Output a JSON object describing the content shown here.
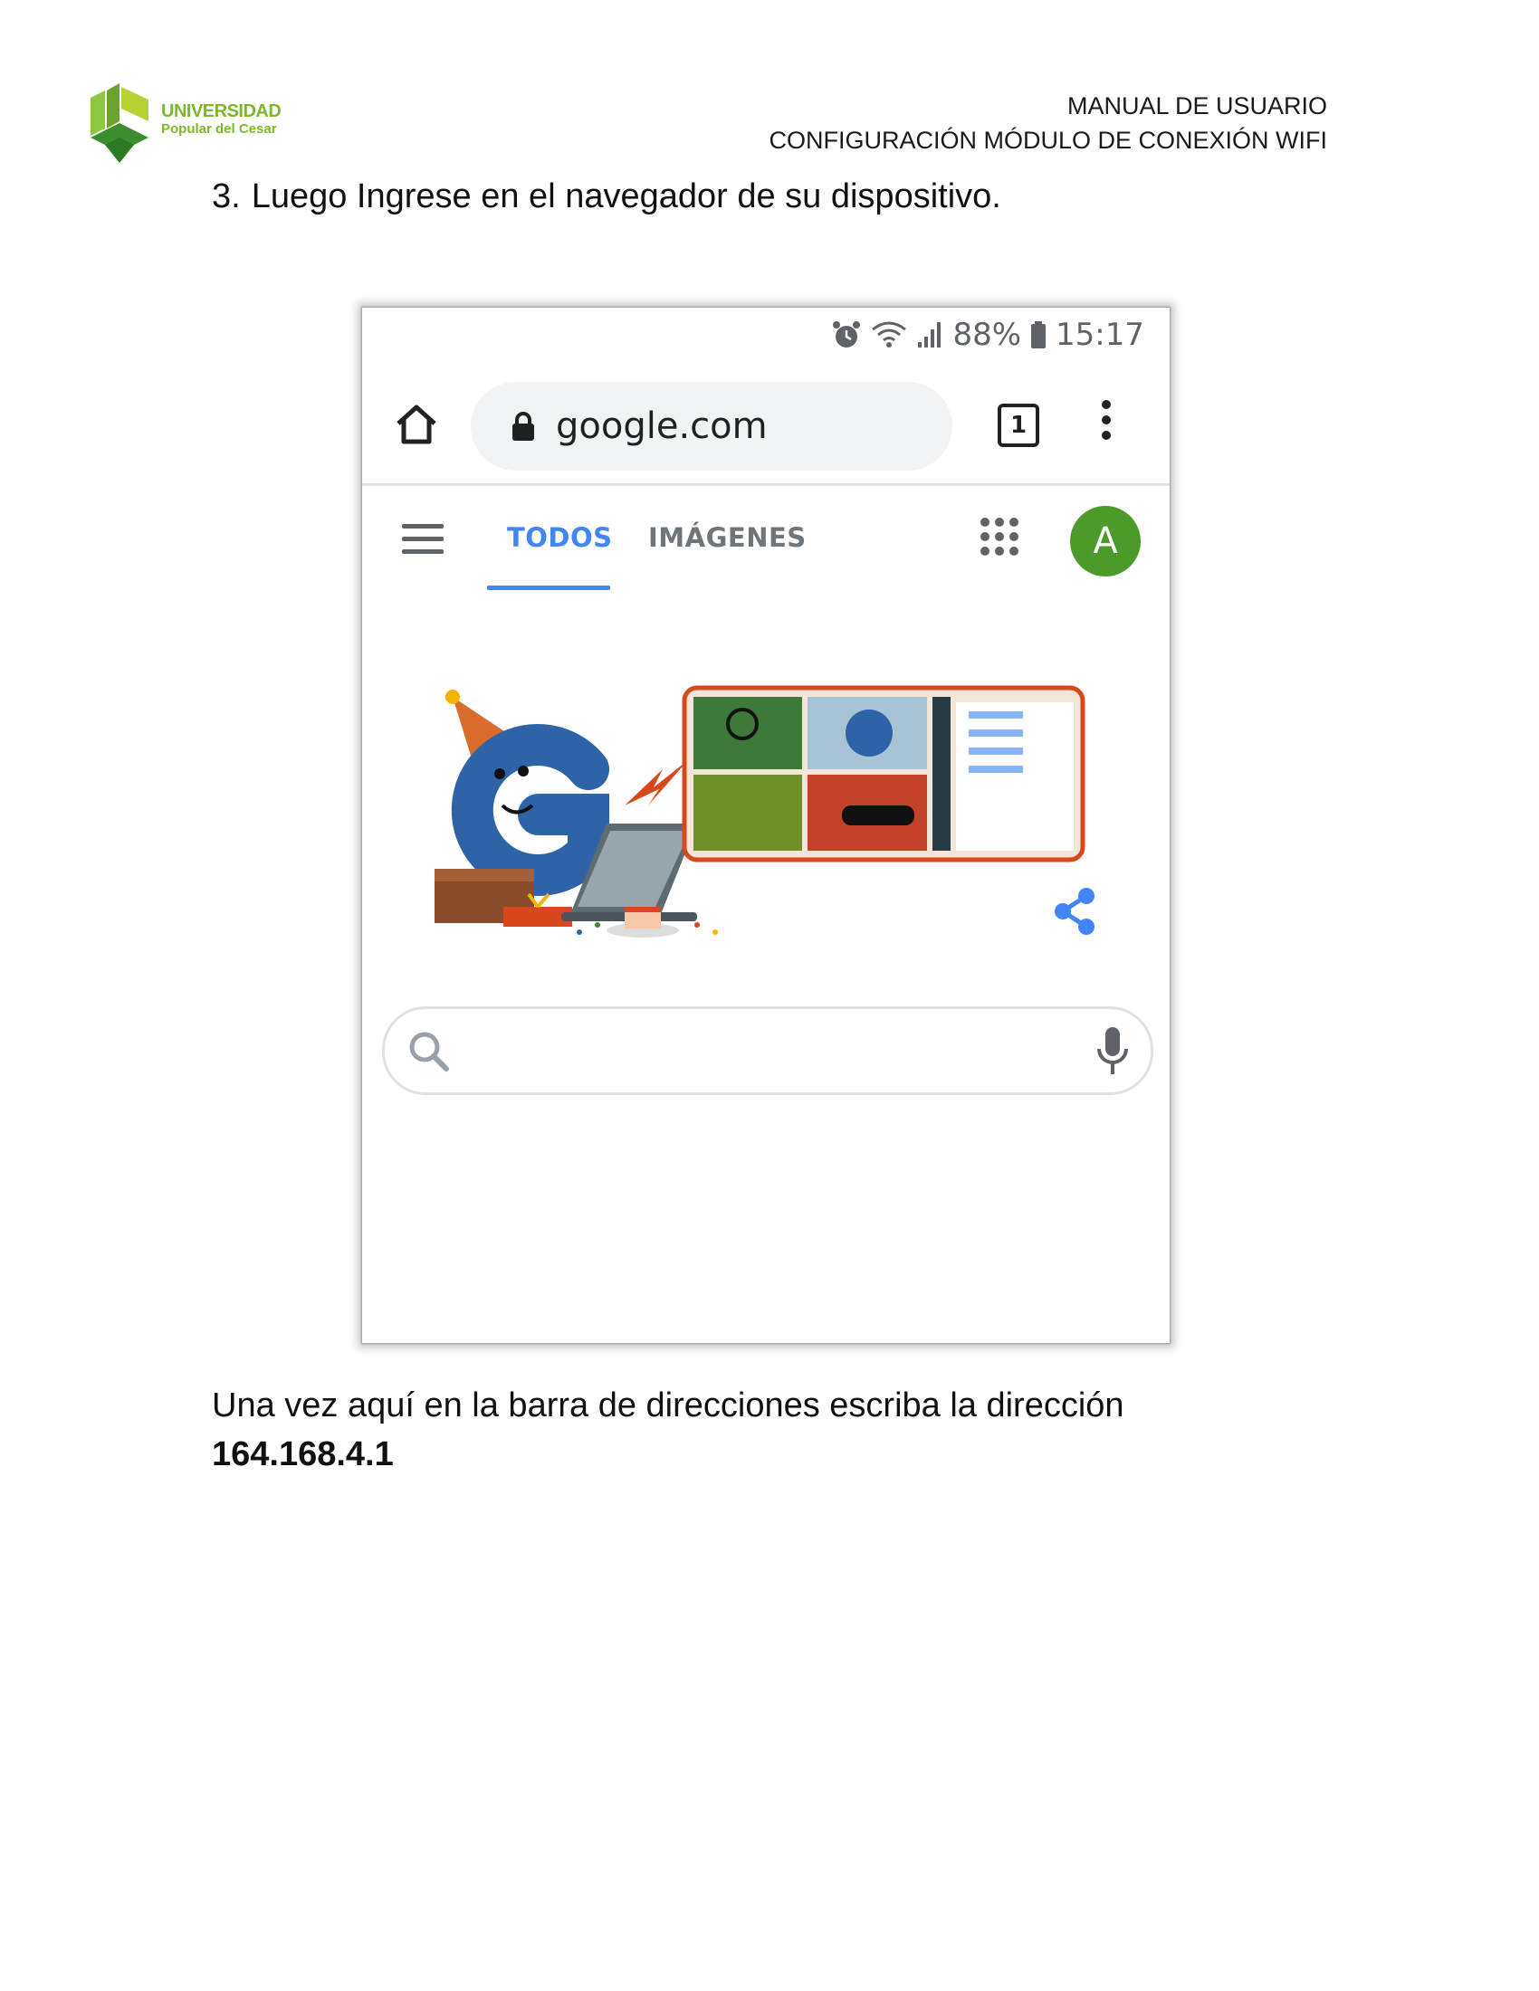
{
  "header": {
    "logo": {
      "line1": "UNIVERSIDAD",
      "line2": "Popular del Cesar"
    },
    "title_line1": "MANUAL DE USUARIO",
    "title_line2": "CONFIGURACIÓN MÓDULO DE CONEXIÓN WIFI"
  },
  "step": {
    "number": "3.",
    "text": "Luego Ingrese en el navegador de su dispositivo."
  },
  "phone": {
    "status": {
      "battery": "88%",
      "time": "15:17"
    },
    "browser": {
      "url": "google.com",
      "tab_count": "1"
    },
    "google": {
      "tabs": [
        "TODOS",
        "IMÁGENES"
      ],
      "active_tab": "TODOS",
      "avatar_letter": "A",
      "colors": {
        "accent": "#4285f4",
        "avatar": "#4c9a2a"
      }
    },
    "icons": [
      "alarm-icon",
      "wifi-icon",
      "signal-icon",
      "battery-icon",
      "home-icon",
      "lock-icon",
      "tabs-icon",
      "more-vert-icon",
      "hamburger-icon",
      "apps-icon",
      "search-icon",
      "mic-icon",
      "share-icon"
    ]
  },
  "paragraph": {
    "text": "Una vez aquí en la barra de direcciones escriba la dirección",
    "ip": "164.168.4.1"
  }
}
